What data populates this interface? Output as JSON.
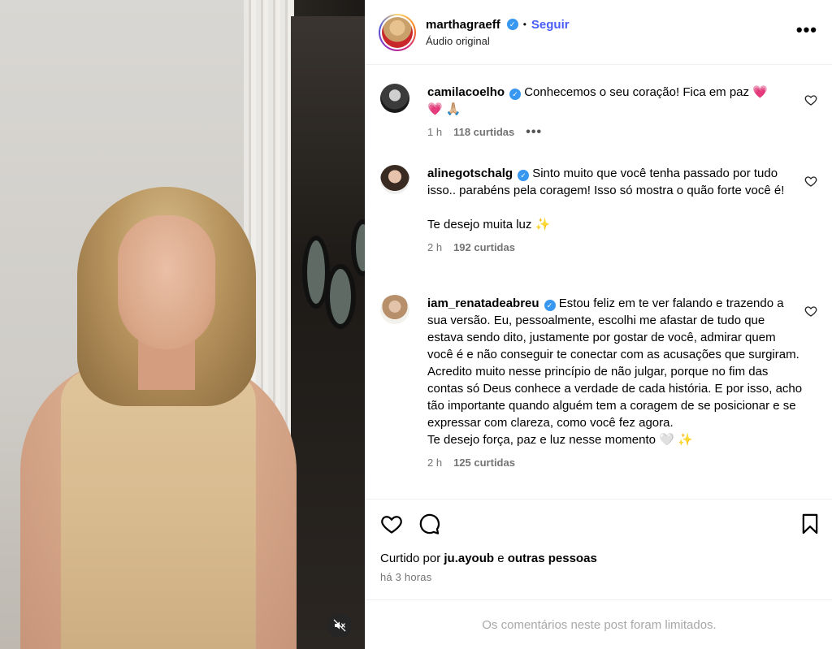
{
  "post": {
    "author": "marthagraeff",
    "follow_label": "Seguir",
    "separator": "•",
    "audio": "Áudio original",
    "more_label": "•••"
  },
  "comments": [
    {
      "username": "camilacoelho",
      "text": "Conhecemos o seu coração! Fica em paz 💗",
      "text_line2": "💗 🙏🏼",
      "time": "1 h",
      "likes": "118 curtidas",
      "more": "•••"
    },
    {
      "username": "alinegotschalg",
      "text": "Sinto muito que você tenha passado por tudo isso.. parabéns pela coragem! Isso só mostra o quão forte você é!",
      "text_line2": "Te desejo muita luz ✨",
      "time": "2 h",
      "likes": "192 curtidas"
    },
    {
      "username": "iam_renatadeabreu",
      "text": "Estou feliz em te ver falando e trazendo a sua versão. Eu, pessoalmente, escolhi me afastar de tudo que estava sendo dito, justamente por gostar de você, admirar quem você é e não conseguir te conectar com as acusações que surgiram.",
      "text_line2": "Acredito muito nesse princípio de não julgar, porque no fim das contas só Deus conhece a verdade de cada história. E por isso, acho tão importante quando alguém tem a coragem de se posicionar e se expressar com clareza, como você fez agora.",
      "text_line3": "Te desejo força, paz e luz nesse momento 🤍 ✨",
      "time": "2 h",
      "likes": "125 curtidas"
    }
  ],
  "footer": {
    "liked_prefix": "Curtido por",
    "liked_user": "ju.ayoub",
    "liked_conj": "e",
    "liked_others": "outras pessoas",
    "time_ago": "há 3 horas",
    "limited_text": "Os comentários neste post foram limitados."
  },
  "colors": {
    "follow": "#4a5df9",
    "verified": "#3897f0",
    "muted_text": "#737373"
  },
  "icons": {
    "verified": "verified-badge-icon",
    "heart": "heart-icon",
    "comment": "comment-icon",
    "bookmark": "bookmark-icon",
    "mute": "speaker-muted-icon"
  }
}
